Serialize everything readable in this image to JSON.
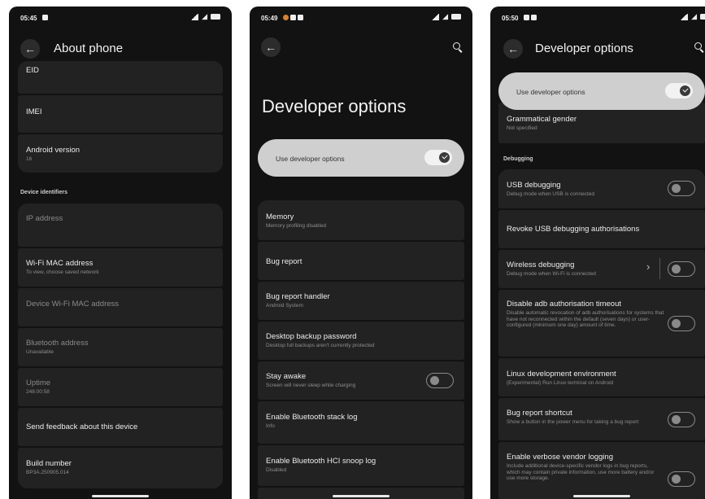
{
  "phone1": {
    "time": "05:45",
    "title": "About phone",
    "items_top": [
      {
        "title": "EID",
        "subtitle": ""
      },
      {
        "title": "IMEI",
        "subtitle": ""
      },
      {
        "title": "Android version",
        "subtitle": "16"
      }
    ],
    "section": "Device identifiers",
    "items": [
      {
        "title": "IP address",
        "subtitle": ""
      },
      {
        "title": "Wi-Fi MAC address",
        "subtitle": "To view, choose saved network"
      },
      {
        "title": "Device Wi-Fi MAC address",
        "subtitle": ""
      },
      {
        "title": "Bluetooth address",
        "subtitle": "Unavailable"
      },
      {
        "title": "Uptime",
        "subtitle": "248:00:58"
      },
      {
        "title": "Send feedback about this device",
        "subtitle": ""
      },
      {
        "title": "Build number",
        "subtitle": "BP3A.250905.014"
      }
    ]
  },
  "phone2": {
    "time": "05:49",
    "title": "Developer options",
    "master_label": "Use developer options",
    "master_on": true,
    "items": [
      {
        "title": "Memory",
        "subtitle": "Memory profiling disabled"
      },
      {
        "title": "Bug report",
        "subtitle": ""
      },
      {
        "title": "Bug report handler",
        "subtitle": "Android System"
      },
      {
        "title": "Desktop backup password",
        "subtitle": "Desktop full backups aren't currently protected"
      },
      {
        "title": "Stay awake",
        "subtitle": "Screen will never sleep while charging",
        "toggle": false
      },
      {
        "title": "Enable Bluetooth stack log",
        "subtitle": "Info"
      },
      {
        "title": "Enable Bluetooth HCI snoop log",
        "subtitle": "Disabled"
      }
    ]
  },
  "phone3": {
    "time": "05:50",
    "title": "Developer options",
    "master_label": "Use developer options",
    "master_on": true,
    "top_item": {
      "title": "Grammatical gender",
      "subtitle": "Not specified"
    },
    "section": "Debugging",
    "items": [
      {
        "title": "USB debugging",
        "subtitle": "Debug mode when USB is connected",
        "toggle": false
      },
      {
        "title": "Revoke USB debugging authorisations",
        "subtitle": ""
      },
      {
        "title": "Wireless debugging",
        "subtitle": "Debug mode when Wi-Fi is connected",
        "toggle": false
      },
      {
        "title": "Disable adb authorisation timeout",
        "subtitle": "Disable automatic revocation of adb authorisations for systems that have not reconnected within the default (seven days) or user-configured (minimum one day) amount of time.",
        "toggle": false
      },
      {
        "title": "Linux development environment",
        "subtitle": "(Experimental) Run Linux terminal on Android"
      },
      {
        "title": "Bug report shortcut",
        "subtitle": "Show a button in the power menu for taking a bug report",
        "toggle": false
      },
      {
        "title": "Enable verbose vendor logging",
        "subtitle": "Include additional device-specific vendor logs in bug reports, which may contain private information, use more battery and/or use more storage.",
        "toggle": false
      }
    ]
  },
  "icons": {
    "back": "arrow-left-icon",
    "search": "search-icon",
    "chevron": "chevron-right-icon"
  }
}
